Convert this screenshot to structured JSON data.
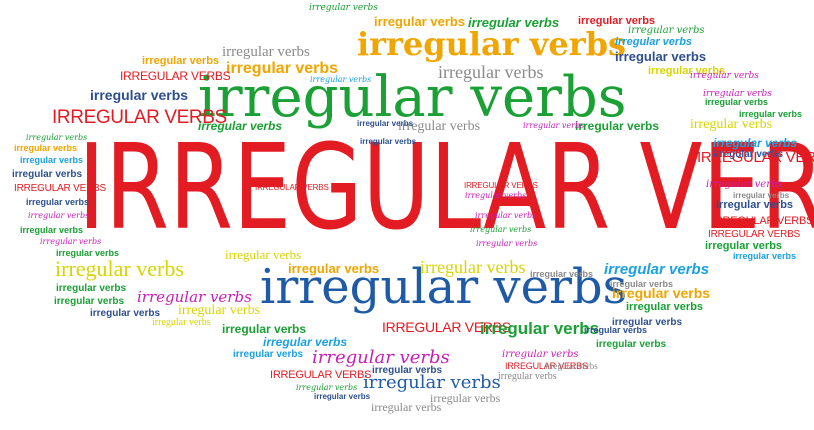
{
  "words": {
    "lower": "irregular verbs",
    "upper": "IRREGULAR VERBS"
  },
  "colors": {
    "red": "#e31b23",
    "blue": "#1f5aa6",
    "green": "#1aa035",
    "orange": "#f0a500",
    "yellow": "#d8d400",
    "gray": "#8a8a8a",
    "sky": "#1ba0e0",
    "magenta": "#c81fb8",
    "navy": "#2d4f8e"
  }
}
